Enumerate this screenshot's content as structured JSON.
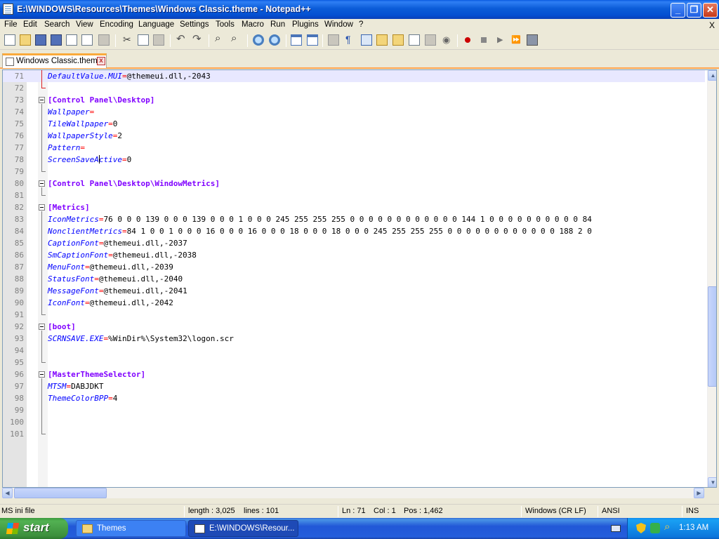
{
  "window": {
    "title": "E:\\WINDOWS\\Resources\\Themes\\Windows Classic.theme - Notepad++",
    "minimize_label": "_",
    "maximize_label": "❐",
    "close_label": "✕"
  },
  "menu": {
    "items": [
      "File",
      "Edit",
      "Search",
      "View",
      "Encoding",
      "Language",
      "Settings",
      "Tools",
      "Macro",
      "Run",
      "Plugins",
      "Window",
      "?"
    ],
    "doc_close_label": "X"
  },
  "tab": {
    "label": "Windows Classic.theme",
    "close_label": "x"
  },
  "editor": {
    "lines": [
      {
        "num": "71",
        "type": "kv",
        "key": "DefaultValue.MUI",
        "value": "@themeui.dll,-2043"
      },
      {
        "num": "72",
        "type": "blank"
      },
      {
        "num": "73",
        "type": "section",
        "text": "[Control Panel\\Desktop]"
      },
      {
        "num": "74",
        "type": "kv",
        "key": "Wallpaper",
        "value": ""
      },
      {
        "num": "75",
        "type": "kv",
        "key": "TileWallpaper",
        "value": "0"
      },
      {
        "num": "76",
        "type": "kv",
        "key": "WallpaperStyle",
        "value": "2"
      },
      {
        "num": "77",
        "type": "kv",
        "key": "Pattern",
        "value": ""
      },
      {
        "num": "78",
        "type": "kv",
        "key": "ScreenSaveActive",
        "value": "0"
      },
      {
        "num": "79",
        "type": "blank"
      },
      {
        "num": "80",
        "type": "section",
        "text": "[Control Panel\\Desktop\\WindowMetrics]"
      },
      {
        "num": "81",
        "type": "blank"
      },
      {
        "num": "82",
        "type": "section",
        "text": "[Metrics]"
      },
      {
        "num": "83",
        "type": "kv",
        "key": "IconMetrics",
        "value": "76 0 0 0 139 0 0 0 139 0 0 0 1 0 0 0 245 255 255 255 0 0 0 0 0 0 0 0 0 0 0 0 144 1 0 0 0 0 0 0 0 0 0 0 84"
      },
      {
        "num": "84",
        "type": "kv",
        "key": "NonclientMetrics",
        "value": "84 1 0 0 1 0 0 0 16 0 0 0 16 0 0 0 18 0 0 0 18 0 0 0 245 255 255 255 0 0 0 0 0 0 0 0 0 0 0 0 188 2 0"
      },
      {
        "num": "85",
        "type": "kv",
        "key": "CaptionFont",
        "value": "@themeui.dll,-2037"
      },
      {
        "num": "86",
        "type": "kv",
        "key": "SmCaptionFont",
        "value": "@themeui.dll,-2038"
      },
      {
        "num": "87",
        "type": "kv",
        "key": "MenuFont",
        "value": "@themeui.dll,-2039"
      },
      {
        "num": "88",
        "type": "kv",
        "key": "StatusFont",
        "value": "@themeui.dll,-2040"
      },
      {
        "num": "89",
        "type": "kv",
        "key": "MessageFont",
        "value": "@themeui.dll,-2041"
      },
      {
        "num": "90",
        "type": "kv",
        "key": "IconFont",
        "value": "@themeui.dll,-2042"
      },
      {
        "num": "91",
        "type": "blank"
      },
      {
        "num": "92",
        "type": "section",
        "text": "[boot]"
      },
      {
        "num": "93",
        "type": "kv",
        "key": "SCRNSAVE.EXE",
        "value": "%WinDir%\\System32\\logon.scr"
      },
      {
        "num": "94",
        "type": "blank"
      },
      {
        "num": "95",
        "type": "blank"
      },
      {
        "num": "96",
        "type": "section",
        "text": "[MasterThemeSelector]"
      },
      {
        "num": "97",
        "type": "kv",
        "key": "MTSM",
        "value": "DABJDKT"
      },
      {
        "num": "98",
        "type": "kv",
        "key": "ThemeColorBPP",
        "value": "4"
      },
      {
        "num": "99",
        "type": "blank"
      },
      {
        "num": "100",
        "type": "blank"
      },
      {
        "num": "101",
        "type": "blank"
      }
    ]
  },
  "status": {
    "file_type": "MS ini file",
    "length": "length : 3,025",
    "lines": "lines : 101",
    "ln": "Ln : 71",
    "col": "Col : 1",
    "pos": "Pos : 1,462",
    "eol": "Windows (CR LF)",
    "encoding": "ANSI",
    "mode": "INS"
  },
  "taskbar": {
    "start_label": "start",
    "tasks": [
      {
        "label": "Themes"
      },
      {
        "label": "E:\\WINDOWS\\Resour..."
      }
    ],
    "clock": "1:13 AM"
  },
  "colors": {
    "section": "#8000FF",
    "key": "#0000FF",
    "equals": "#FF0000",
    "current_line": "#E8E8FF",
    "tab_accent": "#FAAA3C"
  }
}
